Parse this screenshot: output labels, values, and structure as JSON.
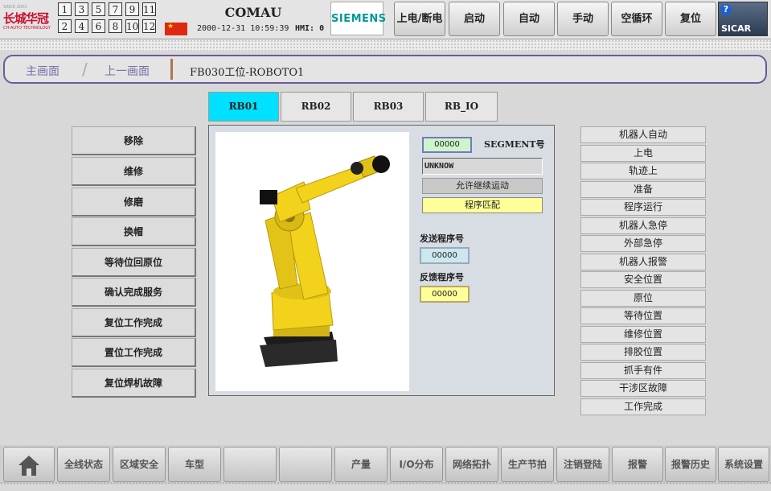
{
  "header": {
    "logo_text": "长城华冠",
    "logo_sub": "CH-AUTO TECHNOLOGY",
    "logo_top": "SINCE 2003",
    "stations_row1": [
      "1",
      "3",
      "5",
      "7",
      "9",
      "11"
    ],
    "stations_row2": [
      "2",
      "4",
      "6",
      "8",
      "10",
      "12"
    ],
    "brand": "COMAU",
    "datetime": "2000-12-31 10:59:39",
    "hmi": "HMI: 0",
    "siemens": "SIEMENS",
    "buttons": [
      "上电/断电",
      "启动",
      "自动",
      "手动",
      "空循环",
      "复位"
    ],
    "help": "?",
    "sicar": "SICAR"
  },
  "breadcrumb": {
    "home": "主画面",
    "separator": "/",
    "back": "上一画面",
    "title": "FB030工位-ROBOTO1"
  },
  "robot_tabs": [
    {
      "label": "RB01",
      "active": true
    },
    {
      "label": "RB02",
      "active": false
    },
    {
      "label": "RB03",
      "active": false
    },
    {
      "label": "RB_IO",
      "active": false
    }
  ],
  "left_actions": [
    "移除",
    "维修",
    "修磨",
    "换帽",
    "等待位回原位",
    "确认完成服务",
    "复位工作完成",
    "置位工作完成",
    "复位焊机故障"
  ],
  "panel": {
    "segment_value": "00000",
    "segment_label": "SEGMENT号",
    "program_name": "UNKNOW",
    "allow_continue": "允许继续运动",
    "program_match": "程序匹配",
    "send_label": "发送程序号",
    "send_value": "00000",
    "feedback_label": "反馈程序号",
    "feedback_value": "00000"
  },
  "status_items": [
    "机器人自动",
    "上电",
    "轨迹上",
    "准备",
    "程序运行",
    "机器人急停",
    "外部急停",
    "机器人报警",
    "安全位置",
    "原位",
    "等待位置",
    "维修位置",
    "排胶位置",
    "抓手有件",
    "干涉区故障",
    "工作完成"
  ],
  "bottom_nav": [
    "全线状态",
    "区域安全",
    "车型",
    "",
    "",
    "产量",
    "I/O分布",
    "网络拓扑",
    "生产节拍",
    "注销登陆",
    "报警",
    "报警历史",
    "系统设置"
  ],
  "colors": {
    "active_tab": "#00e0ff",
    "robot_yellow": "#f2d21b",
    "match_yellow": "#ffff99",
    "segment_green": "#ccf5cc"
  }
}
